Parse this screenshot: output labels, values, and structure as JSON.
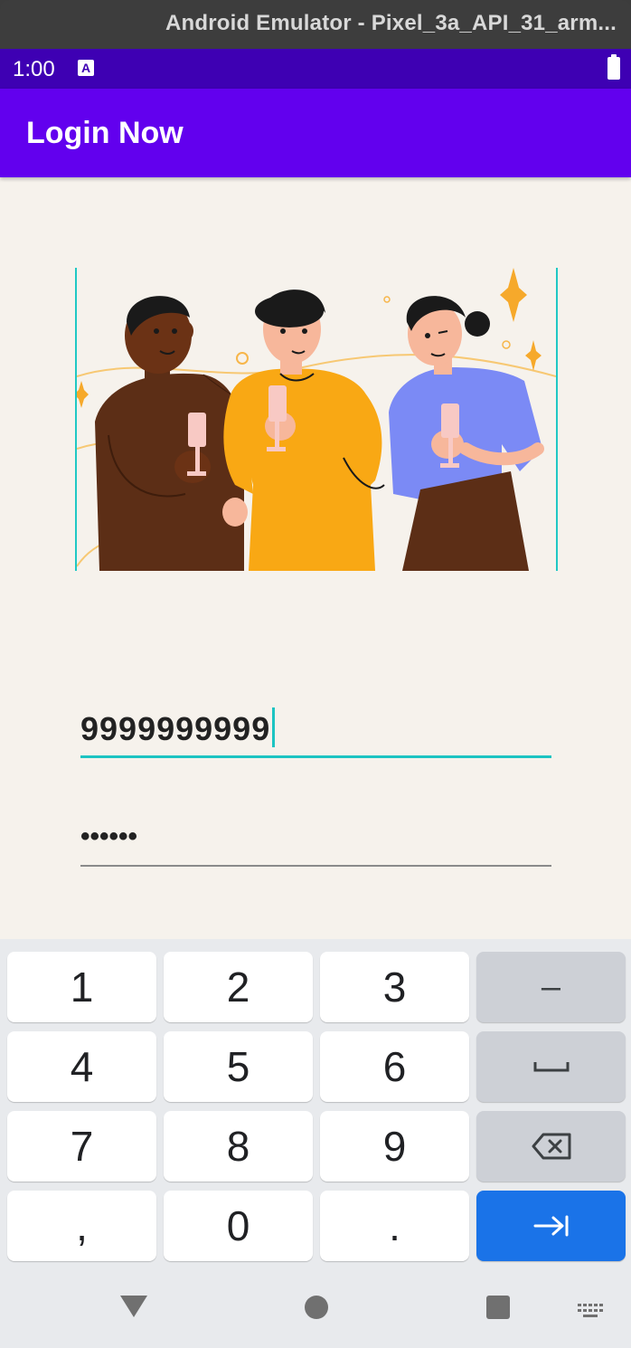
{
  "window": {
    "title": "Android Emulator - Pixel_3a_API_31_arm..."
  },
  "status_bar": {
    "time": "1:00",
    "notification_letter": "A"
  },
  "app_bar": {
    "title": "Login Now"
  },
  "form": {
    "phone_value": "9999999999",
    "password_value": "••••••"
  },
  "keyboard": {
    "rows": [
      [
        "1",
        "2",
        "3",
        "–"
      ],
      [
        "4",
        "5",
        "6",
        "space"
      ],
      [
        "7",
        "8",
        "9",
        "backspace"
      ],
      [
        ",",
        "0",
        ".",
        "next"
      ]
    ],
    "action_color": "#1a73e8"
  },
  "colors": {
    "app_bar": "#6200ee",
    "status_bar": "#3e00b3",
    "accent": "#1cc4c2",
    "background": "#f6f2ec"
  },
  "icons": {
    "battery": "battery-icon",
    "notification": "notification-a-icon",
    "back": "nav-back-icon",
    "home": "nav-home-icon",
    "recents": "nav-recents-icon",
    "keyboard_switch": "keyboard-switch-icon"
  }
}
